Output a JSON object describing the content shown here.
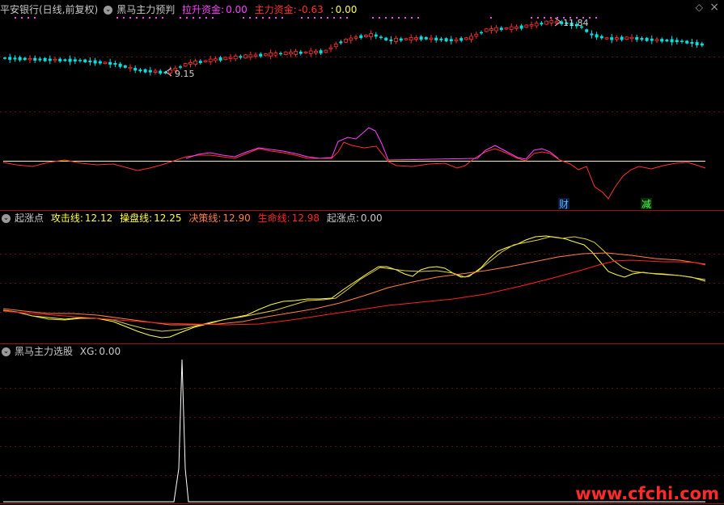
{
  "panel1": {
    "stock_title": "平安银行(日线,前复权)",
    "indicator_name": "黑马主力预判",
    "items": [
      {
        "label": "拉升资金",
        "value": "0.00",
        "color": "#ff40ff"
      },
      {
        "label": "主力资金",
        "value": "-0.63",
        "color": "#ff3030"
      },
      {
        "label": "",
        "value": "0.00",
        "color": "#ffff40"
      }
    ],
    "low_price_label": "9.15",
    "high_price_label": "11.84",
    "signal_cai": "财",
    "signal_jian": "减",
    "close_label": "×",
    "restore_label": "◇"
  },
  "panel2": {
    "indicator_name": "起涨点",
    "items": [
      {
        "label": "攻击线",
        "value": "12.12",
        "color": "#ffff40"
      },
      {
        "label": "操盘线",
        "value": "12.25",
        "color": "#ffff40"
      },
      {
        "label": "决策线",
        "value": "12.90",
        "color": "#ff8040"
      },
      {
        "label": "生命线",
        "value": "12.98",
        "color": "#ff2020"
      },
      {
        "label": "起涨点",
        "value": "0.00",
        "color": "#c8c8c8"
      }
    ]
  },
  "panel3": {
    "indicator_name": "黑马主力选股",
    "items": [
      {
        "label": "XG",
        "value": "0.00",
        "color": "#c8c8c8"
      }
    ]
  },
  "watermark": "www.cfchi.com",
  "colors": {
    "background": "#000000",
    "divider": "#a01010",
    "grid": "#5a1010",
    "up_candle": "#ff3030",
    "down_candle": "#00e0e0",
    "attack_line": "#ffff40",
    "operate_line": "#ffff40",
    "decision_line": "#ff8040",
    "life_line": "#ff2020",
    "zero_line": "#ffff40",
    "pull_funds": "#ff40ff",
    "main_funds": "#ff3030"
  }
}
